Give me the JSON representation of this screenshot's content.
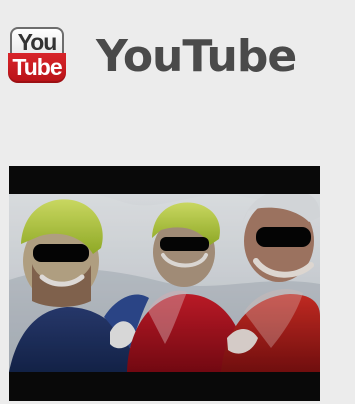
{
  "header": {
    "logo": {
      "top_text": "You",
      "bottom_text": "Tube"
    },
    "title": "YouTube"
  },
  "video": {
    "thumbnail_icon": "video-thumbnail-icon"
  },
  "colors": {
    "background": "#ececec",
    "title": "#4a4a4a",
    "brand_red": "#d8252a"
  }
}
